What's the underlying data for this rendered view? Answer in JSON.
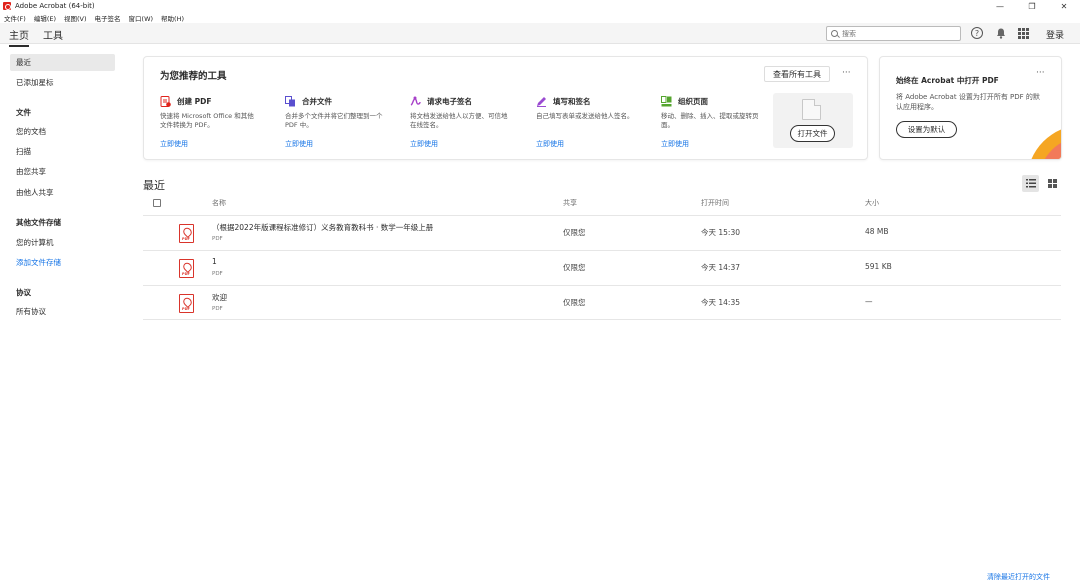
{
  "window": {
    "title": "Adobe Acrobat (64-bit)",
    "controls": [
      "—",
      "❐",
      "✕"
    ]
  },
  "menu": [
    "文件(F)",
    "编辑(E)",
    "视图(V)",
    "电子签名",
    "窗口(W)",
    "帮助(H)"
  ],
  "tabs": {
    "home": "主页",
    "tools": "工具"
  },
  "search": {
    "placeholder": "搜索"
  },
  "header": {
    "login": "登录"
  },
  "sidebar": {
    "recent": "最近",
    "starred": "已添加星标",
    "files_heading": "文件",
    "your_docs": "您的文档",
    "scan": "扫描",
    "shared_by_you": "由您共享",
    "shared_by_others": "由他人共享",
    "other_storage_heading": "其他文件存储",
    "your_computer": "您的计算机",
    "add_storage": "添加文件存储",
    "agreements_heading": "协议",
    "all_agreements": "所有协议"
  },
  "tools_card": {
    "title": "为您推荐的工具",
    "see_all": "查看所有工具",
    "more": "···",
    "open_file": "打开文件",
    "tools": [
      {
        "name": "创建 PDF",
        "desc": "快速将 Microsoft Office 和其他文件转换为 PDF。",
        "link": "立即使用",
        "color": "#e0231c"
      },
      {
        "name": "合并文件",
        "desc": "合并多个文件并将它们整理到一个 PDF 中。",
        "link": "立即使用",
        "color": "#5a4fcf"
      },
      {
        "name": "请求电子签名",
        "desc": "将文档发送给他人以方便、可信地在线签名。",
        "link": "立即使用",
        "color": "#a740c9"
      },
      {
        "name": "填写和签名",
        "desc": "自己填写表单或发送给他人签名。",
        "link": "立即使用",
        "color": "#9a4bd1"
      },
      {
        "name": "组织页面",
        "desc": "移动、删除、插入、提取或旋转页面。",
        "link": "立即使用",
        "color": "#54a52e"
      }
    ]
  },
  "default_card": {
    "title": "始终在 Acrobat 中打开 PDF",
    "desc": "将 Adobe Acrobat 设置为打开所有 PDF 的默认应用程序。",
    "button": "设置为默认",
    "more": "···"
  },
  "recent": {
    "title": "最近",
    "columns": {
      "name": "名称",
      "share": "共享",
      "opened": "打开时间",
      "size": "大小"
    },
    "rows": [
      {
        "name": "（根据2022年版课程标准修订）义务教育教科书 · 数学一年级上册",
        "type": "PDF",
        "share": "仅限您",
        "opened": "今天 15:30",
        "size": "48 MB"
      },
      {
        "name": "1",
        "type": "PDF",
        "share": "仅限您",
        "opened": "今天 14:37",
        "size": "591 KB"
      },
      {
        "name": "欢迎",
        "type": "PDF",
        "share": "仅限您",
        "opened": "今天 14:35",
        "size": "—"
      }
    ],
    "clear_link": "清除最近打开的文件"
  }
}
